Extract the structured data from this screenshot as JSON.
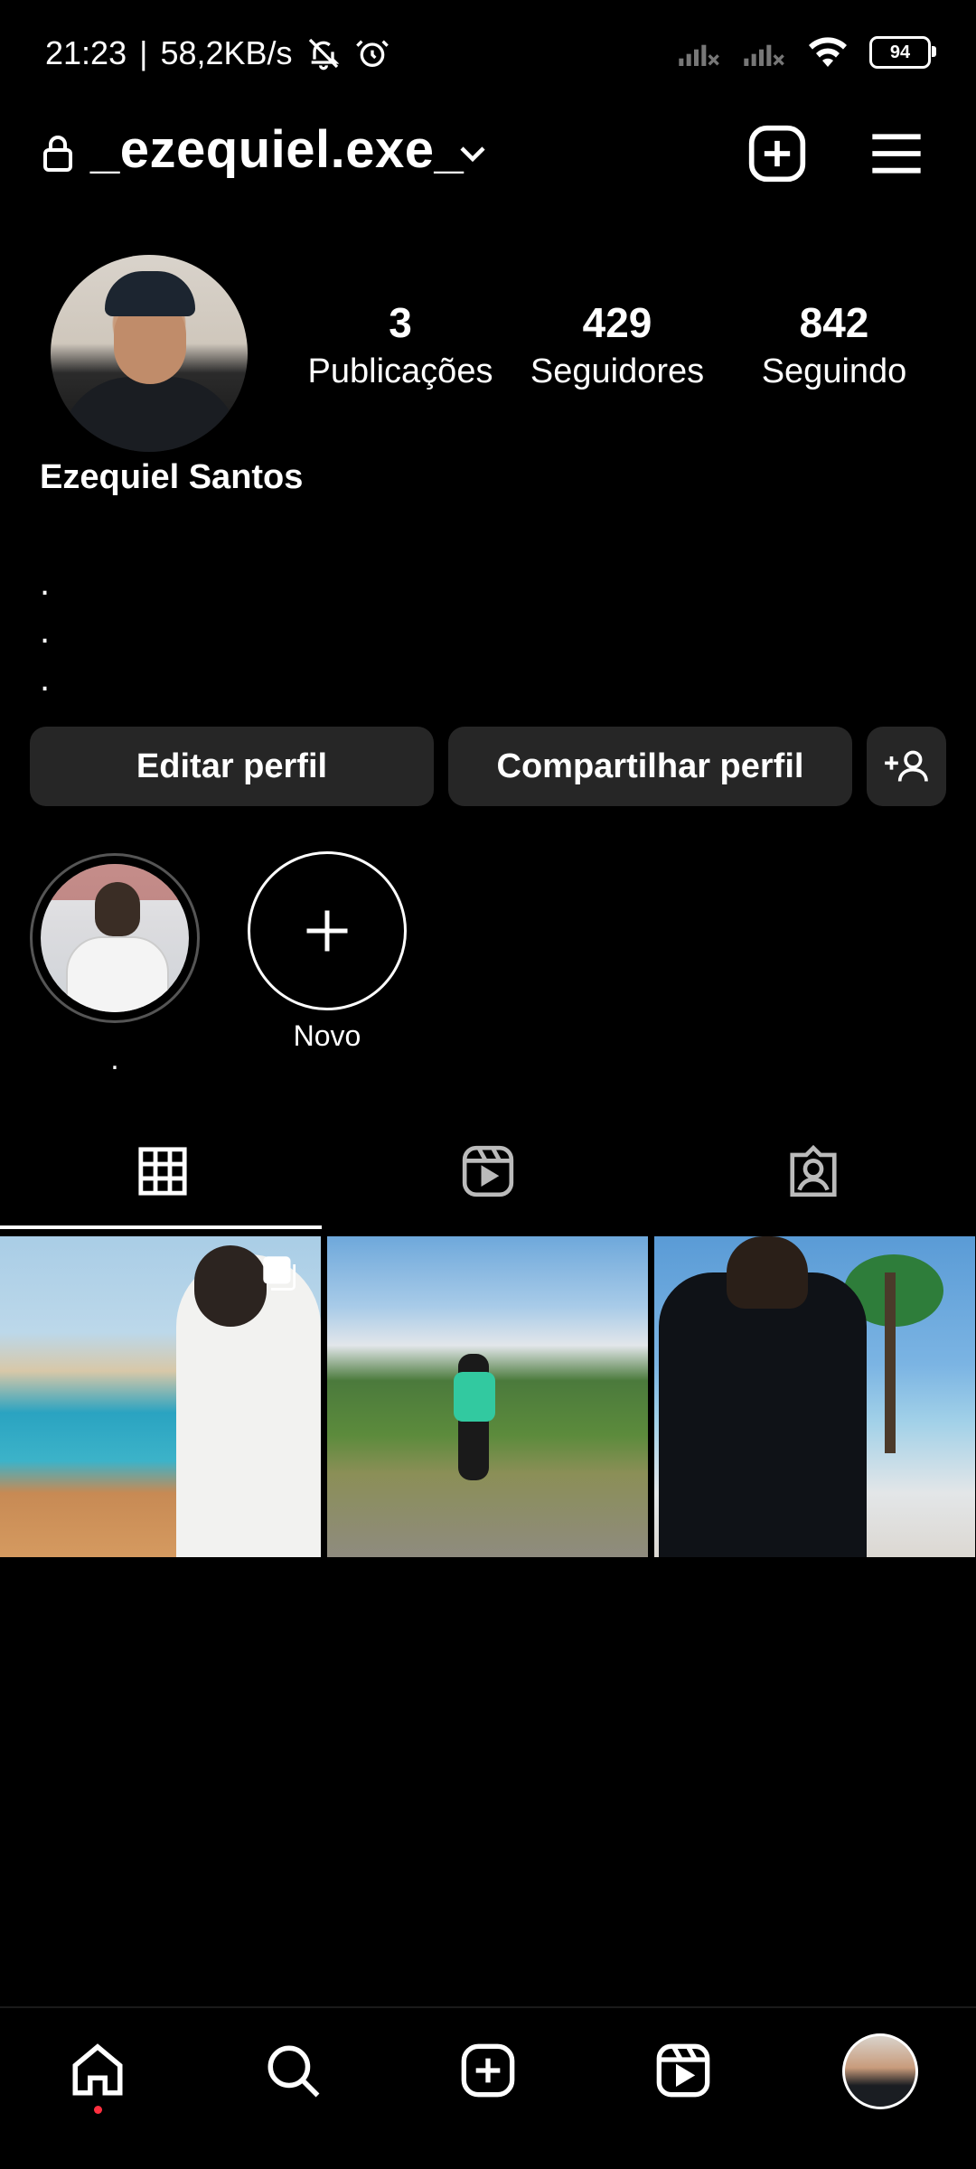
{
  "status": {
    "time": "21:23",
    "speed": "58,2KB/s",
    "battery": "94"
  },
  "header": {
    "username": "_ezequiel.exe_"
  },
  "profile": {
    "stats": [
      {
        "value": "3",
        "label": "Publicações"
      },
      {
        "value": "429",
        "label": "Seguidores"
      },
      {
        "value": "842",
        "label": "Seguindo"
      }
    ],
    "name": "Ezequiel Santos",
    "bio": [
      ".",
      ".",
      "."
    ]
  },
  "buttons": {
    "edit": "Editar perfil",
    "share": "Compartilhar perfil"
  },
  "highlights": [
    {
      "label": "."
    },
    {
      "label": "Novo"
    }
  ],
  "icons": {
    "lock": "lock-icon",
    "chevron": "chevron-down-icon",
    "add": "plus-square-icon",
    "menu": "hamburger-icon",
    "grid": "grid-icon",
    "reels": "reels-icon",
    "tagged": "tagged-icon",
    "home": "home-icon",
    "search": "search-icon",
    "create": "create-icon",
    "reels_nav": "reels-icon",
    "profile": "profile-avatar"
  },
  "colors": {
    "background": "#000000",
    "button": "#262626",
    "notification_dot": "#ff3040"
  }
}
